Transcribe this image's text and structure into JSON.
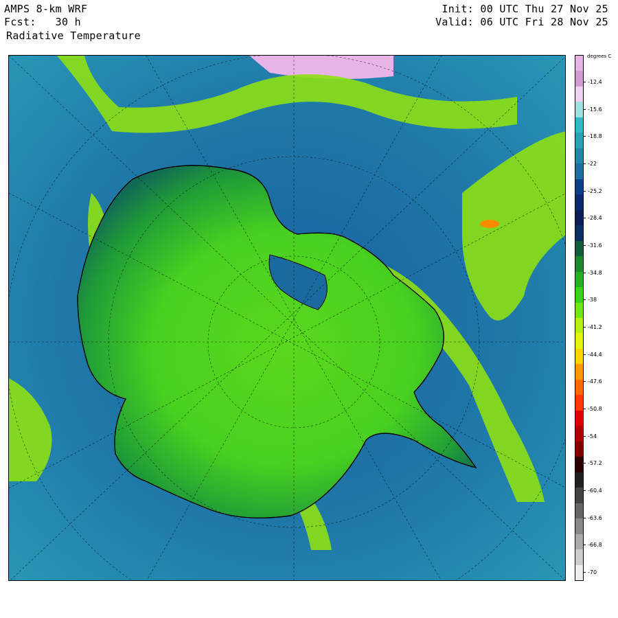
{
  "header": {
    "model": "AMPS 8-km WRF",
    "forecast": "Fcst:   30 h",
    "field": "Radiative Temperature",
    "init": "Init: 00 UTC Thu 27 Nov 25",
    "valid": "Valid: 06 UTC Fri 28 Nov 25"
  },
  "colorbar": {
    "units": "degrees C",
    "ticks": [
      "-12.4",
      "-15.6",
      "-18.8",
      "-22",
      "-25.2",
      "-28.4",
      "-31.6",
      "-34.8",
      "-38",
      "-41.2",
      "-44.4",
      "-47.6",
      "-50.8",
      "-54",
      "-57.2",
      "-60.4",
      "-63.6",
      "-66.8",
      "-70"
    ],
    "colors": [
      "#e8b4e8",
      "#d49ad4",
      "#f0d0f0",
      "#9fe0e0",
      "#33b7c8",
      "#2aa0b8",
      "#1f86a8",
      "#1a6ea0",
      "#0d3f8a",
      "#0a2a70",
      "#0a1e5a",
      "#0b2e66",
      "#0f5f3a",
      "#1a8a2a",
      "#27b024",
      "#3cd01c",
      "#70e616",
      "#b5f012",
      "#e6f50e",
      "#ffd400",
      "#ff9a00",
      "#ff6a00",
      "#ff3a00",
      "#e00000",
      "#b00000",
      "#800000",
      "#300000",
      "#202020",
      "#444444",
      "#666666",
      "#888888",
      "#aaaaaa",
      "#cccccc",
      "#eeeeee"
    ]
  },
  "map": {
    "ocean_color": "#2a8fb0",
    "ice_color": "#3fcf2a",
    "coast_color": "#000000"
  }
}
